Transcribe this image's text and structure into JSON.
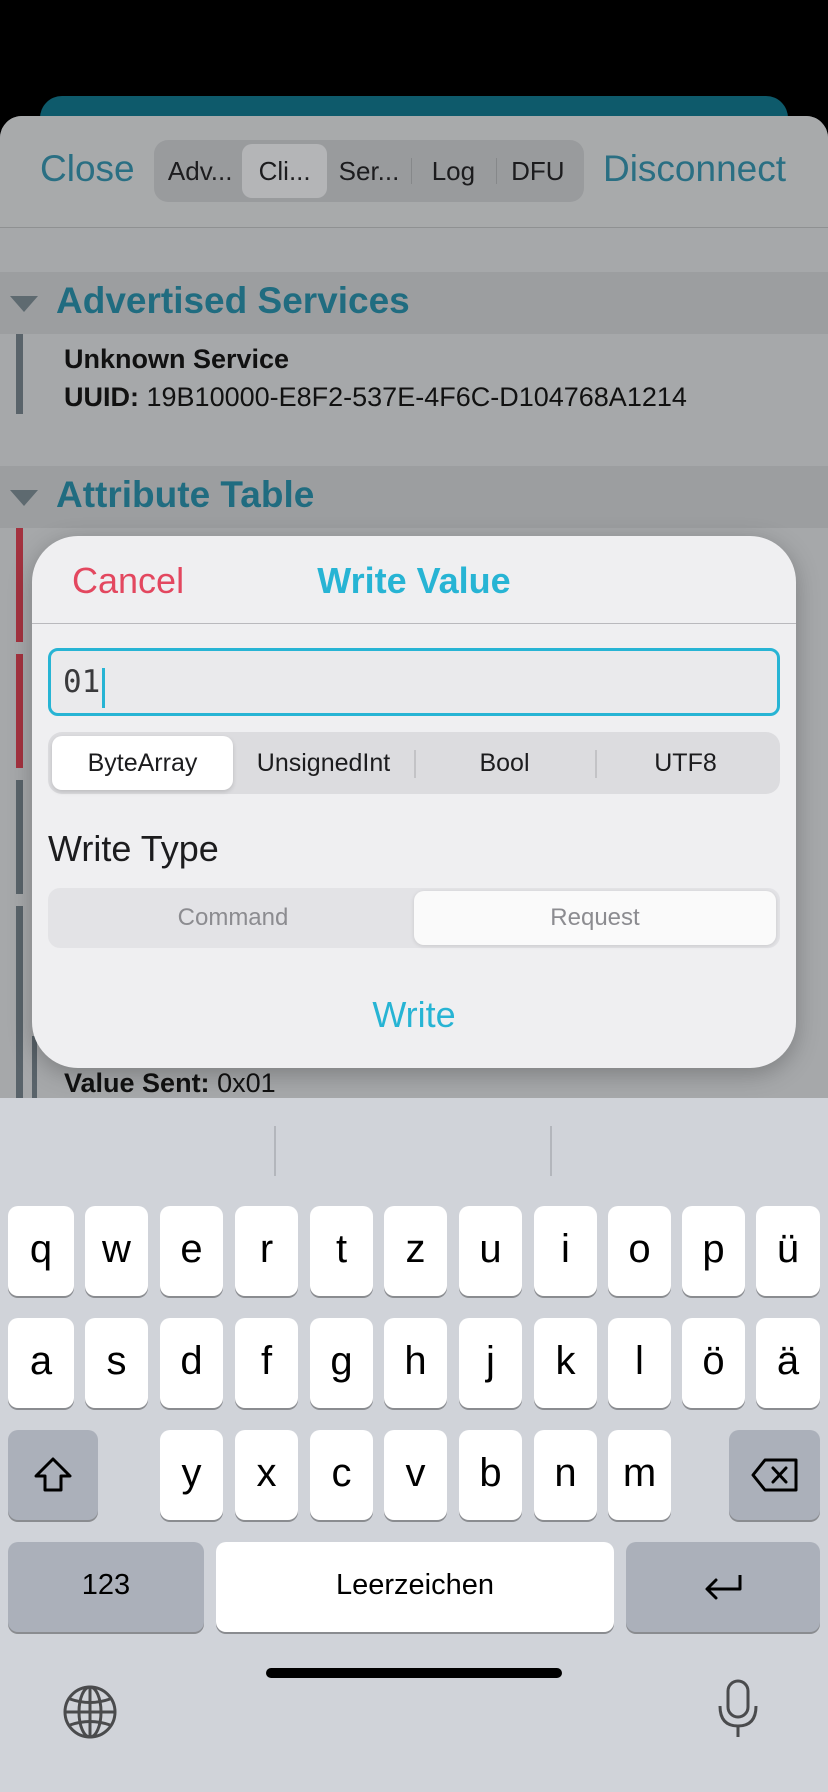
{
  "nav": {
    "close": "Close",
    "disconnect": "Disconnect",
    "tabs": [
      "Adv...",
      "Cli...",
      "Ser...",
      "Log",
      "DFU"
    ],
    "selected_tab": "Cli..."
  },
  "advertised": {
    "title": "Advertised Services",
    "service_name": "Unknown Service",
    "uuid_label": "UUID:",
    "uuid_value": "19B10000-E8F2-537E-4F6C-D104768A1214"
  },
  "attributes": {
    "title": "Attribute Table",
    "value_sent_label": "Value Sent:",
    "value_sent": "0x01"
  },
  "dialog": {
    "cancel": "Cancel",
    "title": "Write Value",
    "input_value": "01",
    "formats": [
      "ByteArray",
      "UnsignedInt",
      "Bool",
      "UTF8"
    ],
    "selected_format": "ByteArray",
    "write_type_label": "Write Type",
    "write_types": [
      "Command",
      "Request"
    ],
    "selected_write_type": "Request",
    "write_button": "Write"
  },
  "keyboard": {
    "row1": [
      "q",
      "w",
      "e",
      "r",
      "t",
      "z",
      "u",
      "i",
      "o",
      "p",
      "ü"
    ],
    "row2": [
      "a",
      "s",
      "d",
      "f",
      "g",
      "h",
      "j",
      "k",
      "l",
      "ö",
      "ä"
    ],
    "row3": [
      "y",
      "x",
      "c",
      "v",
      "b",
      "n",
      "m"
    ],
    "numbers_key": "123",
    "space_key": "Leerzeichen"
  },
  "colors": {
    "accent": "#27b4d4",
    "destructive": "#e3475f",
    "section_title": "#206c80"
  }
}
